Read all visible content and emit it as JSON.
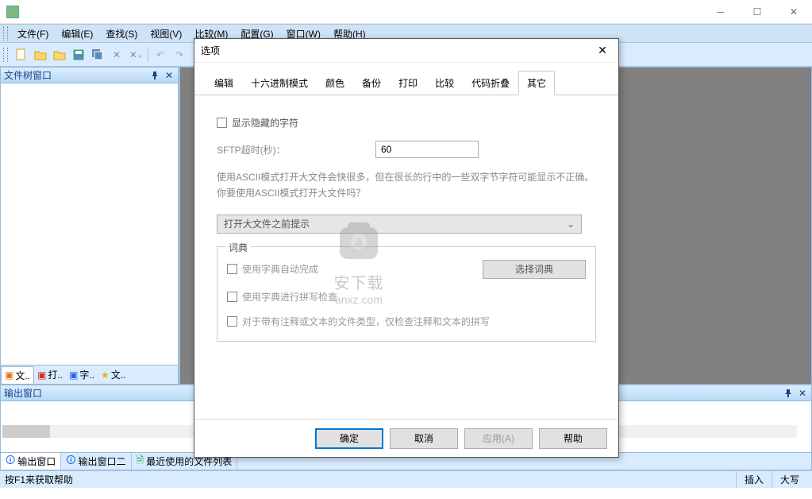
{
  "menubar": [
    "文件(F)",
    "编辑(E)",
    "查找(S)",
    "视图(V)",
    "比较(M)",
    "配置(G)",
    "窗口(W)",
    "帮助(H)"
  ],
  "sidebar": {
    "title": "文件树窗口",
    "tabs": [
      "文..",
      "打..",
      "字..",
      "文.."
    ]
  },
  "output": {
    "title": "输出窗口",
    "tabs": [
      "输出窗口",
      "输出窗口二",
      "最近使用的文件列表"
    ]
  },
  "statusbar": {
    "help": "按F1来获取帮助",
    "insert": "插入",
    "caps": "大写"
  },
  "dialog": {
    "title": "选项",
    "tabs": [
      "编辑",
      "十六进制模式",
      "颜色",
      "备份",
      "打印",
      "比较",
      "代码折叠",
      "其它"
    ],
    "active_tab": 7,
    "show_hidden_chars": "显示隐藏的字符",
    "sftp_label": "SFTP超时(秒)：",
    "sftp_value": "60",
    "ascii_desc": "使用ASCII模式打开大文件会快很多，但在很长的行中的一些双字节字符可能显示不正确。你要使用ASCII模式打开大文件吗？",
    "dropdown_text": "打开大文件之前提示",
    "dict_legend": "词典",
    "use_dict_autocomplete": "使用字典自动完成",
    "select_dict_btn": "选择词典",
    "use_dict_spellcheck": "使用字典进行拼写检查",
    "check_comments_only": "对于带有注释或文本的文件类型，仅检查注释和文本的拼写",
    "buttons": {
      "ok": "确定",
      "cancel": "取消",
      "apply": "应用(A)",
      "help": "帮助"
    }
  },
  "watermark_text": "anxz.com"
}
